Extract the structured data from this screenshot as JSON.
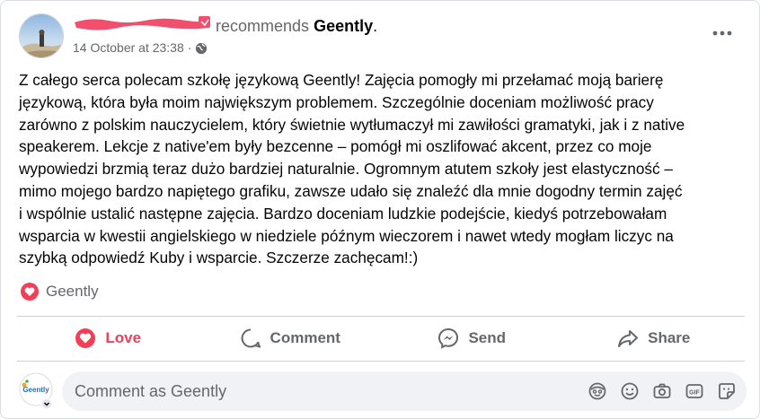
{
  "header": {
    "author_redacted": "",
    "recommends_text": "recommends",
    "page_name": "Geently",
    "period": ".",
    "timestamp": "14 October at 23:38",
    "separator": "·"
  },
  "post": {
    "text": "Z całego serca polecam szkołę językową Geently! Zajęcia pomogły mi przełamać moją barierę\njęzykową, która była moim największym problemem. Szczególnie doceniam możliwość pracy\nzarówno z polskim nauczycielem, który świetnie wytłumaczył mi zawiłości gramatyki, jak i z native\nspeakerem. Lekcje z native'em były bezcenne – pomógł mi oszlifować akcent, przez co moje\nwypowiedzi brzmią teraz dużo bardziej naturalnie. Ogromnym atutem szkoły jest elastyczność –\nmimo mojego bardzo napiętego grafiku, zawsze udało się znaleźć dla mnie dogodny termin zajęć\ni wspólnie ustalić następne zajęcia. Bardzo doceniam ludzkie podejście, kiedyś potrzebowałam\nwsparcia w kwestii angielskiego w niedziele późnym wieczorem i nawet wtedy mogłam liczyc na\nszybką odpowiedź Kuby i wsparcie. Szczerze zachęcam!:)"
  },
  "reactions": {
    "reactor_name": "Geently",
    "love_color": "#f33e58"
  },
  "actions": {
    "love_label": "Love",
    "comment_label": "Comment",
    "send_label": "Send",
    "share_label": "Share"
  },
  "comment_box": {
    "placeholder": "Comment as Geently",
    "avatar_logo_text": "Geently",
    "icons": [
      "avatar-sticker-icon",
      "emoji-icon",
      "camera-icon",
      "gif-icon",
      "sticker-icon"
    ]
  }
}
